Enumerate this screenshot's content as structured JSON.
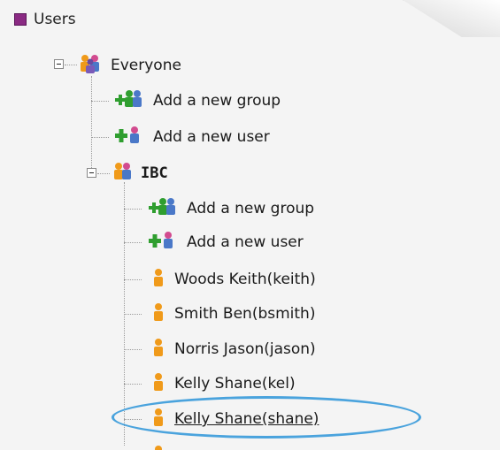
{
  "tree": {
    "root_label": "Users",
    "everyone": {
      "label": "Everyone",
      "add_group_label": "Add a new group",
      "add_user_label": "Add a new user"
    },
    "ibc": {
      "label": "IBC",
      "add_group_label": "Add a new group",
      "add_user_label": "Add a new user",
      "users": [
        "Woods Keith(keith)",
        "Smith Ben(bsmith)",
        "Norris Jason(jason)",
        "Kelly Shane(kel)",
        "Kelly Shane(shane)"
      ]
    }
  },
  "colors": {
    "root_icon": "#8a2a83",
    "highlight_oval": "#4aa3dd",
    "user_icon": "#f09a1a",
    "add_icon": "#2f9e2f"
  },
  "icons": {
    "root": "square-icon",
    "group": "group-icon",
    "add_group": "add-group-icon",
    "add_user": "add-user-icon",
    "user": "user-icon"
  }
}
